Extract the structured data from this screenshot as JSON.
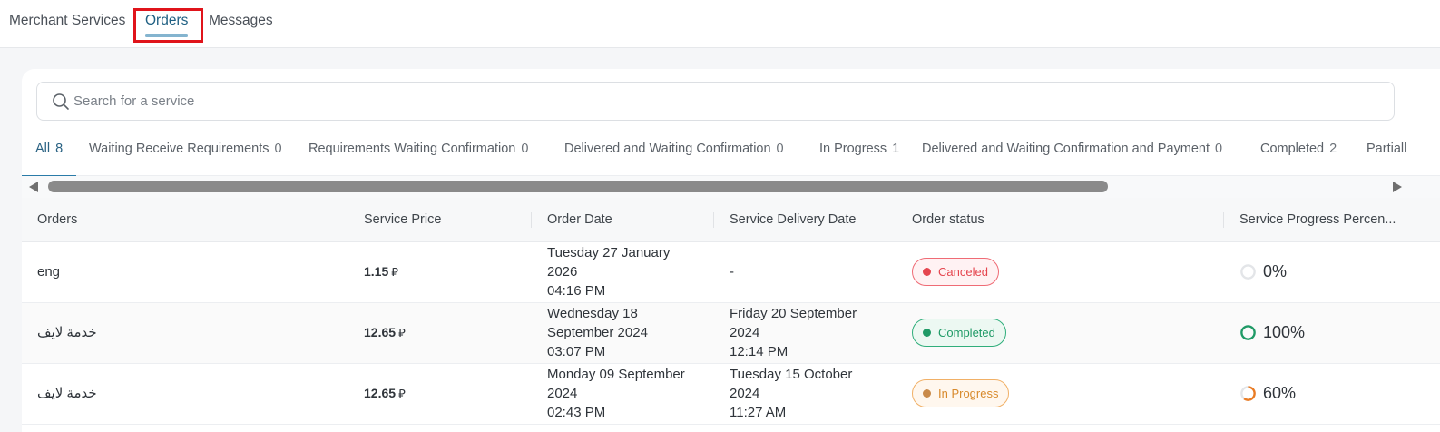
{
  "nav": {
    "tabs": [
      {
        "label": "Merchant Services"
      },
      {
        "label": "Orders"
      },
      {
        "label": "Messages"
      }
    ]
  },
  "search": {
    "placeholder": "Search for a service",
    "value": ""
  },
  "filters": [
    {
      "label": "All",
      "count": "8"
    },
    {
      "label": "Waiting Receive Requirements",
      "count": "0"
    },
    {
      "label": "Requirements Waiting Confirmation",
      "count": "0"
    },
    {
      "label": "Delivered and Waiting Confirmation",
      "count": "0"
    },
    {
      "label": "In Progress",
      "count": "1"
    },
    {
      "label": "Delivered and Waiting Confirmation and Payment",
      "count": "0"
    },
    {
      "label": "Completed",
      "count": "2"
    },
    {
      "label": "Partiall",
      "count": ""
    }
  ],
  "table": {
    "headers": [
      "Orders",
      "Service Price",
      "Order Date",
      "Service Delivery Date",
      "Order status",
      "Service Progress Percen..."
    ],
    "currency_symbol": "⃁",
    "rows": [
      {
        "order": "eng",
        "price": "1.15",
        "order_date": {
          "l1": "Tuesday 27 January",
          "l2": "2026",
          "l3": "04:16 PM"
        },
        "delivery_date": {
          "l1": "-",
          "l2": "",
          "l3": ""
        },
        "status": "Canceled",
        "progress": "0%",
        "progress_value": 0
      },
      {
        "order": "خدمة لايف",
        "price": "12.65",
        "order_date": {
          "l1": "Wednesday 18",
          "l2": "September 2024",
          "l3": "03:07 PM"
        },
        "delivery_date": {
          "l1": "Friday 20 September",
          "l2": "2024",
          "l3": "12:14 PM"
        },
        "status": "Completed",
        "progress": "100%",
        "progress_value": 100
      },
      {
        "order": "خدمة لايف",
        "price": "12.65",
        "order_date": {
          "l1": "Monday 09 September",
          "l2": "2024",
          "l3": "02:43 PM"
        },
        "delivery_date": {
          "l1": "Tuesday 15 October",
          "l2": "2024",
          "l3": "11:27 AM"
        },
        "status": "In Progress",
        "progress": "60%",
        "progress_value": 60
      }
    ]
  },
  "colors": {
    "accent": "#2a6283",
    "canceled": "#e5464f",
    "completed": "#1f9a66",
    "in_progress": "#d88a2c",
    "highlight": "#e0141b"
  },
  "icons": [
    "search-icon",
    "scroll-left-icon",
    "scroll-right-icon",
    "progress-ring-icon"
  ]
}
